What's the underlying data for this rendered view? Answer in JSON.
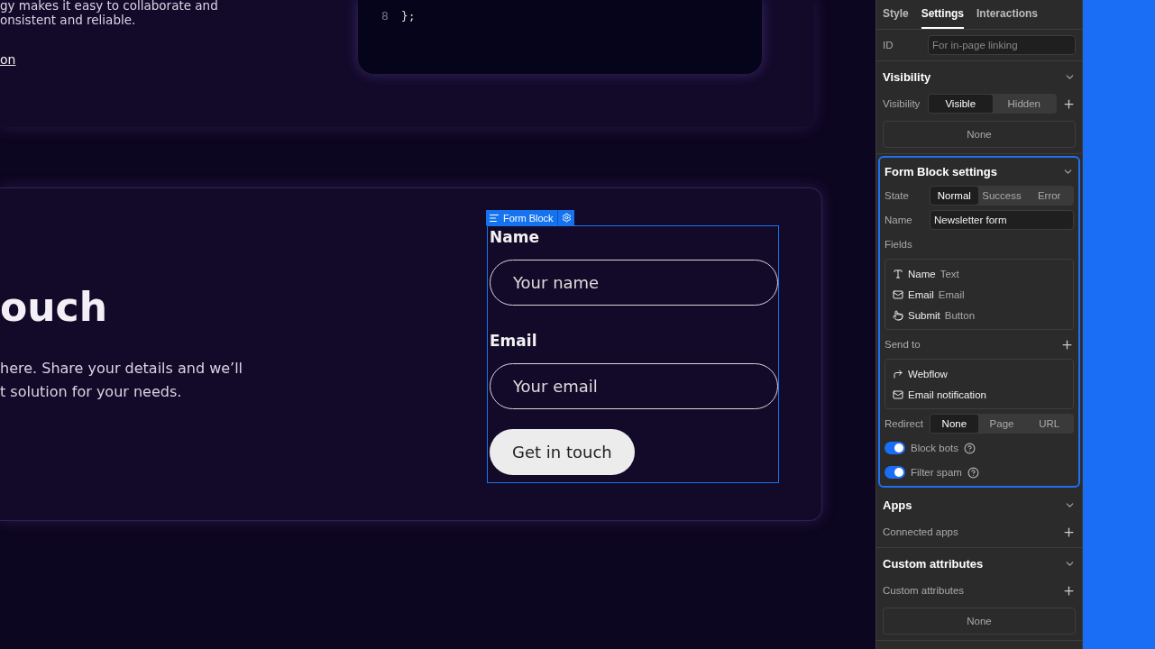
{
  "canvas": {
    "intro_lines": [
      "gy makes it easy to collaborate and",
      "onsistent and reliable."
    ],
    "link": "on",
    "code_lines": [
      {
        "number": "8",
        "code": "};"
      }
    ],
    "heading": "ouch",
    "body_lines": [
      "here. Share your details and we’ll",
      "t solution for your needs."
    ],
    "form_block": {
      "tag": "Form Block",
      "fields": [
        {
          "label": "Name",
          "placeholder": "Your name"
        },
        {
          "label": "Email",
          "placeholder": "Your email"
        }
      ],
      "button": "Get in touch"
    }
  },
  "panel": {
    "tabs": [
      {
        "label": "Style",
        "selected": false
      },
      {
        "label": "Settings",
        "selected": true
      },
      {
        "label": "Interactions",
        "selected": false
      }
    ],
    "id_field": {
      "label": "ID",
      "placeholder": "For in-page linking"
    },
    "visibility": {
      "title": "Visibility",
      "label": "Visibility",
      "options": [
        {
          "label": "Visible",
          "selected": true
        },
        {
          "label": "Hidden",
          "selected": false
        }
      ],
      "empty": "None"
    },
    "form_settings": {
      "title": "Form Block settings",
      "state": {
        "label": "State",
        "options": [
          {
            "label": "Normal",
            "selected": true
          },
          {
            "label": "Success",
            "selected": false
          },
          {
            "label": "Error",
            "selected": false
          }
        ]
      },
      "name": {
        "label": "Name",
        "value": "Newsletter form"
      },
      "fields_label": "Fields",
      "fields": [
        {
          "kind": "text",
          "name": "Name",
          "type": "Text"
        },
        {
          "kind": "email",
          "name": "Email",
          "type": "Email"
        },
        {
          "kind": "button",
          "name": "Submit",
          "type": "Button"
        }
      ],
      "send_to_label": "Send to",
      "destinations": [
        {
          "kind": "forward",
          "label": "Webflow"
        },
        {
          "kind": "email",
          "label": "Email notification"
        }
      ],
      "redirect": {
        "label": "Redirect",
        "options": [
          {
            "label": "None",
            "selected": true
          },
          {
            "label": "Page",
            "selected": false
          },
          {
            "label": "URL",
            "selected": false
          }
        ]
      },
      "toggles": [
        {
          "label": "Block bots",
          "on": true
        },
        {
          "label": "Filter spam",
          "on": true
        }
      ]
    },
    "apps": {
      "title": "Apps",
      "label": "Connected apps"
    },
    "custom_attributes": {
      "title": "Custom attributes",
      "label": "Custom attributes",
      "empty": "None"
    }
  }
}
